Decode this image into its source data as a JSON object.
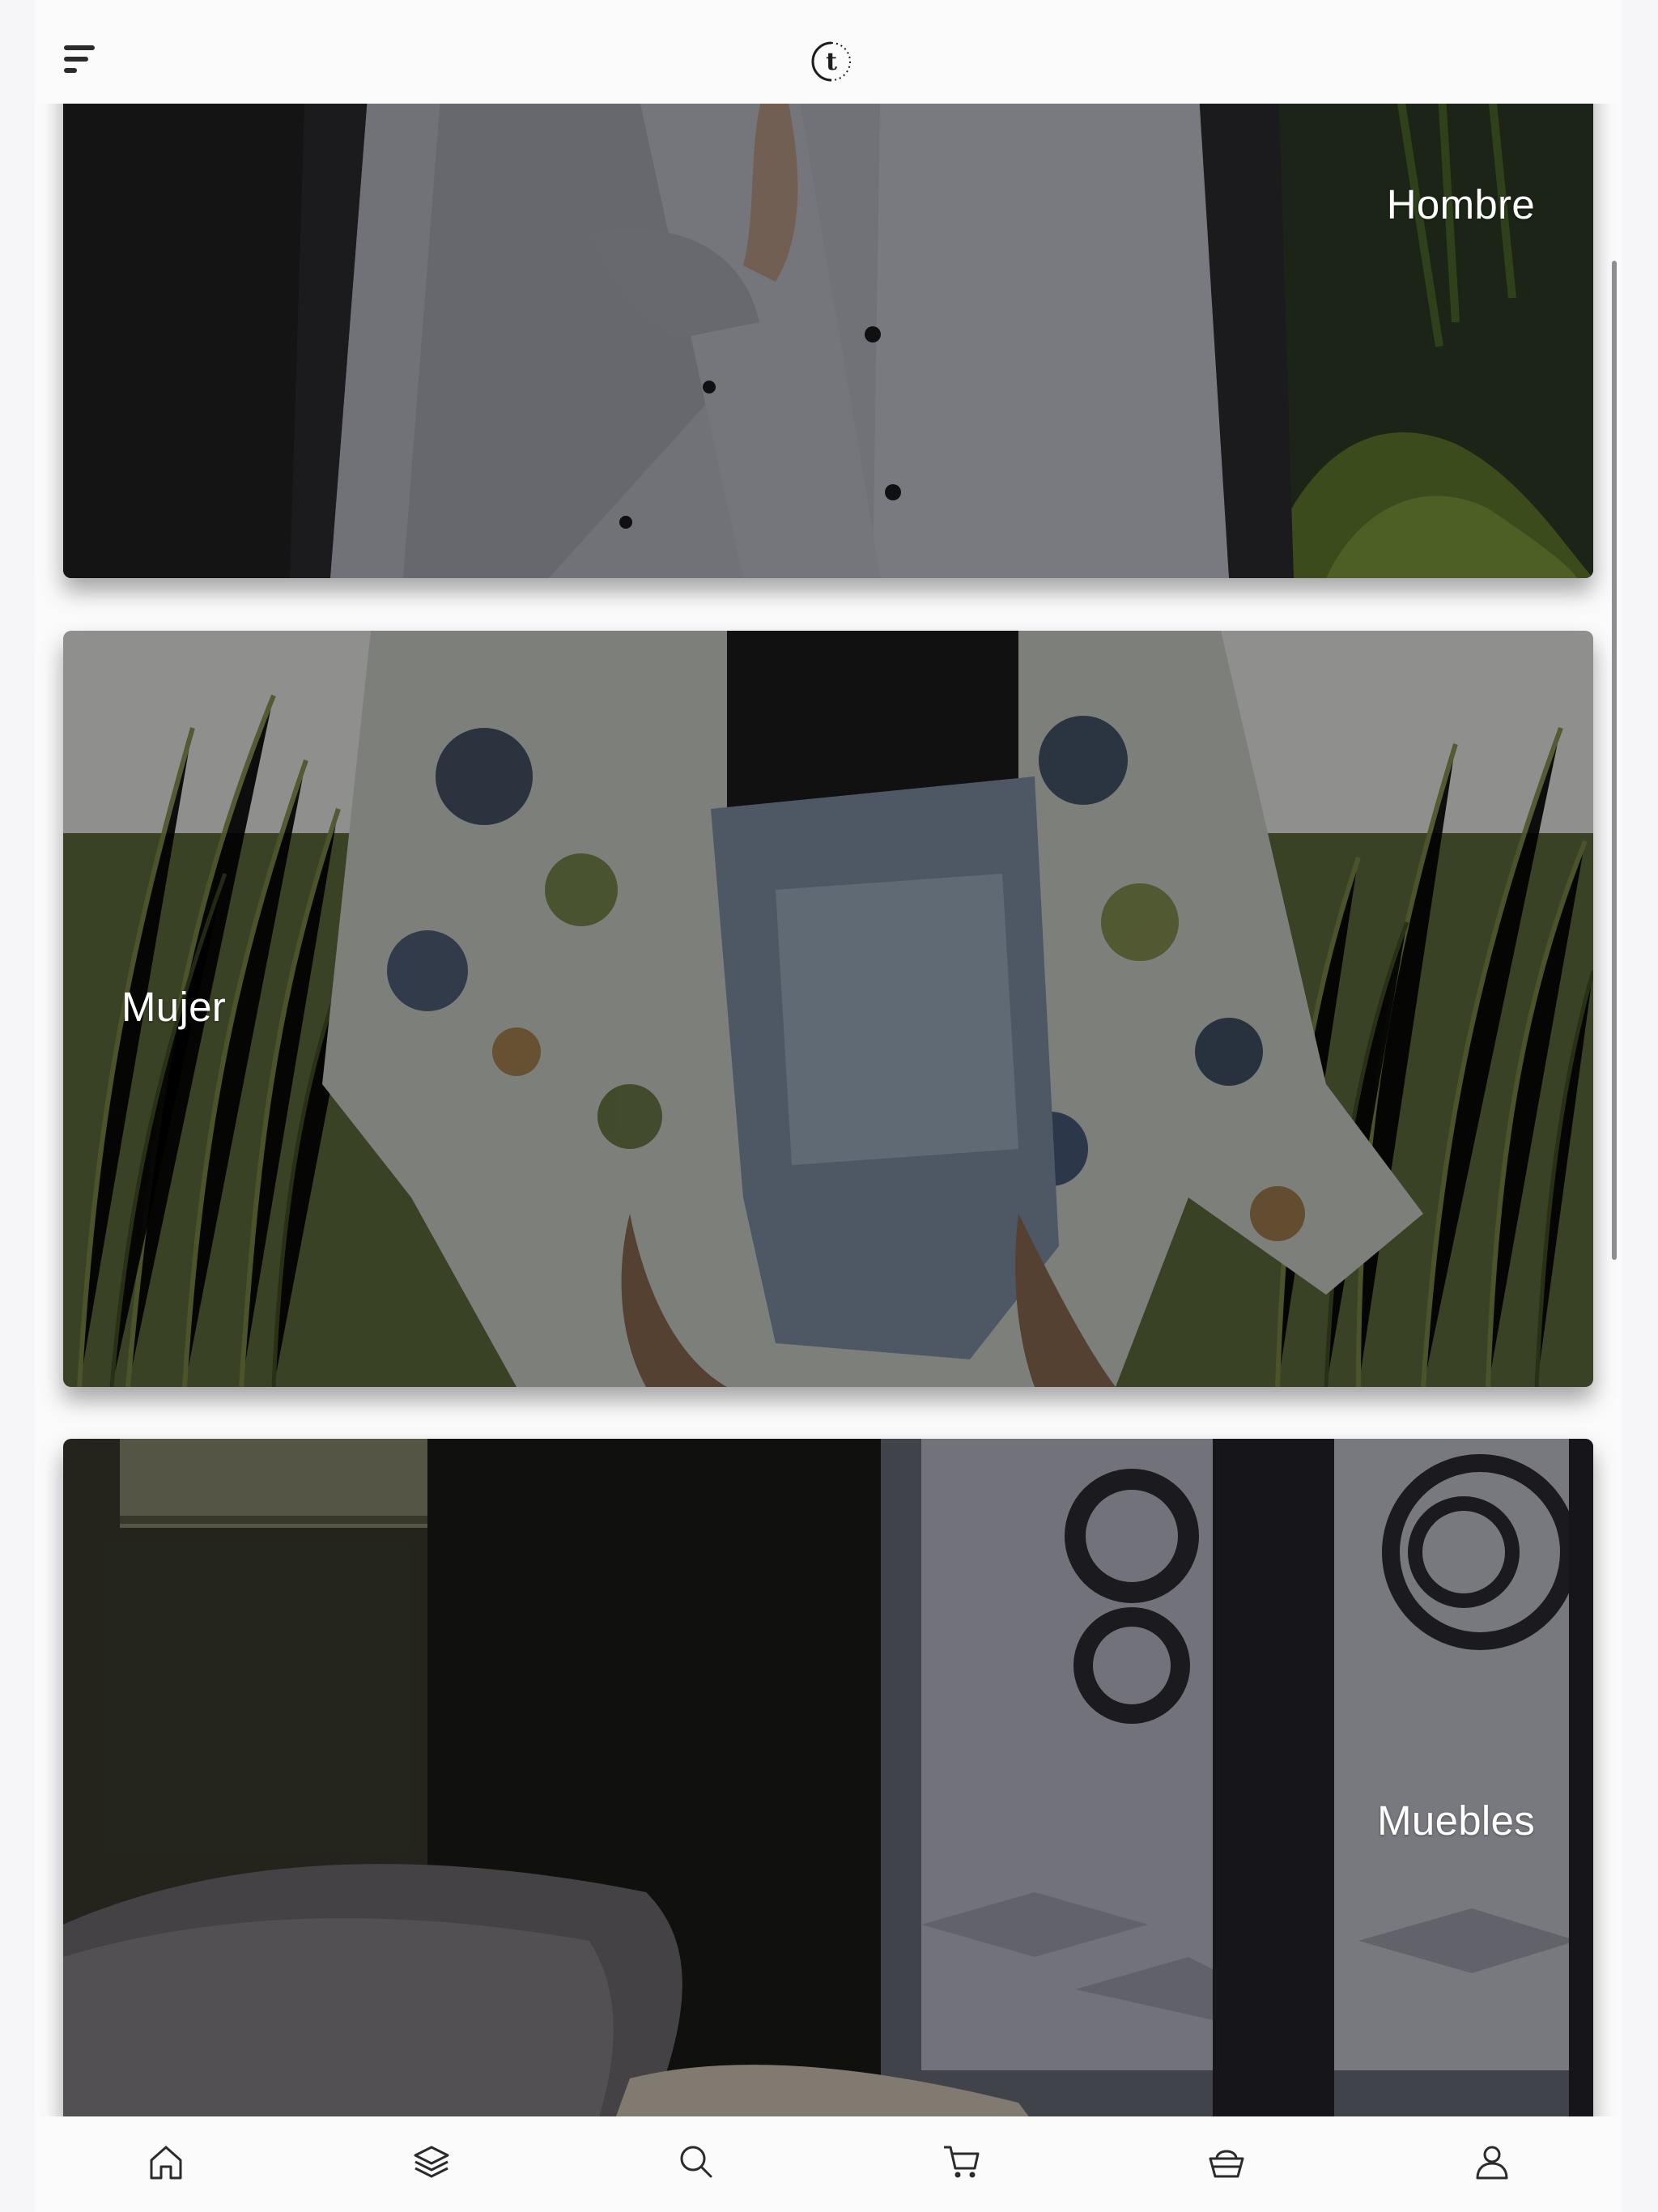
{
  "header": {
    "menu_icon": "menu-icon",
    "logo_icon": "brand-logo-t"
  },
  "categories": [
    {
      "label": "Hombre",
      "image": "man-in-white-shirt"
    },
    {
      "label": "Mujer",
      "image": "woman-in-floral-kimono-and-denim-shorts"
    },
    {
      "label": "Muebles",
      "image": "bedroom-furniture-with-fur-pillow"
    }
  ],
  "bottom_nav": [
    {
      "icon": "home-icon"
    },
    {
      "icon": "layers-icon"
    },
    {
      "icon": "search-icon"
    },
    {
      "icon": "cart-icon"
    },
    {
      "icon": "basket-icon"
    },
    {
      "icon": "user-icon"
    }
  ],
  "colors": {
    "background": "#fbfbfc",
    "icon": "#2b2b2e",
    "label": "#ffffff",
    "image_overlay": "rgba(0,0,0,0.38)"
  }
}
